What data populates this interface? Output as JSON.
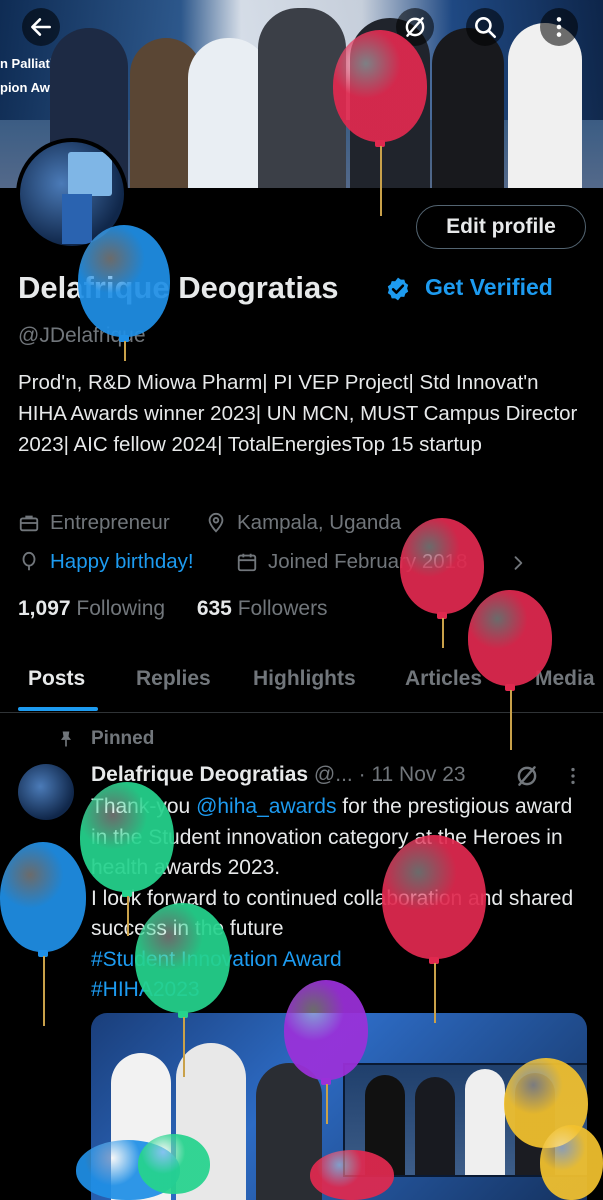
{
  "header": {
    "back_icon": "arrow-left-icon",
    "buttons": [
      "no-sync-icon",
      "search-icon",
      "more-vertical-icon"
    ],
    "banner_text_1": "n Palliati",
    "banner_text_2": "pion Aw"
  },
  "profile": {
    "edit_label": "Edit profile",
    "name": "Delafrique Deogratias",
    "get_verified": "Get Verified",
    "handle": "@JDelafrique",
    "bio": "Prod'n, R&D  Miowa Pharm| PI VEP Project| Std Innovat'n HIHA Awards winner 2023| UN MCN, MUST Campus Director 2023| AIC fellow 2024| TotalEnergiesTop 15 startup",
    "profession": "Entrepreneur",
    "location": "Kampala, Uganda",
    "birthday": "Happy birthday!",
    "joined": "Joined February 2018",
    "following_count": "1,097",
    "following_label": "Following",
    "followers_count": "635",
    "followers_label": "Followers"
  },
  "tabs": [
    "Posts",
    "Replies",
    "Highlights",
    "Articles",
    "Media"
  ],
  "active_tab": "Posts",
  "pinned_tweet": {
    "pinned_label": "Pinned",
    "author": "Delafrique Deogratias",
    "handle_short": "@...",
    "date": "· 11 Nov 23",
    "text_1": "Thank-you ",
    "mention": "@hiha_awards",
    "text_2": " for the prestigious award in the Student innovation category at the Heroes in health awards 2023.",
    "text_3": "I look forward to continued collaboration and shared success in the future",
    "hashtag_1": "#Student Innovation Award",
    "hashtag_2": "#HIHA2023"
  },
  "colors": {
    "accent": "#1d9bf0",
    "background": "#000000",
    "muted": "#71767b",
    "balloon_red": "#e0294f",
    "balloon_blue": "#1f8fe6",
    "balloon_green": "#25d38d",
    "balloon_purple": "#9b30d9",
    "balloon_yellow": "#f2c12e"
  }
}
